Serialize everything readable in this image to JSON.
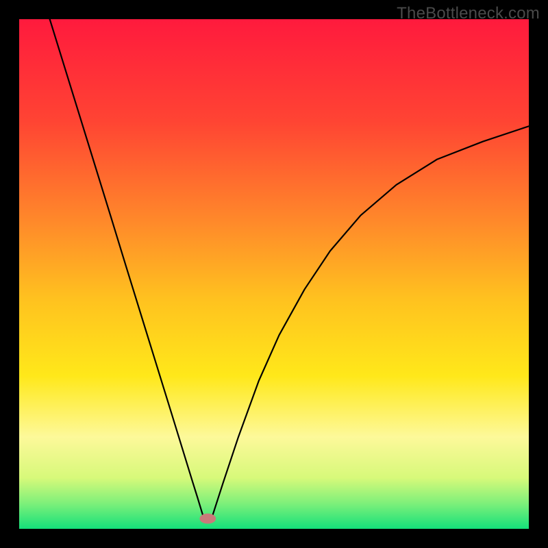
{
  "watermark": "TheBottleneck.com",
  "chart_data": {
    "type": "line",
    "title": "",
    "xlabel": "",
    "ylabel": "",
    "xlim": [
      0,
      1
    ],
    "ylim": [
      0,
      1
    ],
    "background": {
      "type": "vertical-gradient",
      "stops": [
        {
          "pos": 0.0,
          "color": "#ff1a3d"
        },
        {
          "pos": 0.2,
          "color": "#ff4433"
        },
        {
          "pos": 0.4,
          "color": "#ff8a2a"
        },
        {
          "pos": 0.55,
          "color": "#ffc21f"
        },
        {
          "pos": 0.7,
          "color": "#ffe81a"
        },
        {
          "pos": 0.82,
          "color": "#fdf99a"
        },
        {
          "pos": 0.9,
          "color": "#d7f97a"
        },
        {
          "pos": 0.95,
          "color": "#7ef07a"
        },
        {
          "pos": 1.0,
          "color": "#14e07a"
        }
      ]
    },
    "grid": false,
    "series": [
      {
        "name": "left-branch",
        "stroke": "#000000",
        "x": [
          0.06,
          0.09,
          0.12,
          0.15,
          0.18,
          0.21,
          0.24,
          0.27,
          0.3,
          0.32,
          0.34,
          0.35,
          0.36
        ],
        "y": [
          1.0,
          0.903,
          0.806,
          0.709,
          0.612,
          0.514,
          0.417,
          0.32,
          0.223,
          0.158,
          0.093,
          0.061,
          0.028
        ]
      },
      {
        "name": "right-branch",
        "stroke": "#000000",
        "x": [
          0.38,
          0.4,
          0.43,
          0.47,
          0.51,
          0.56,
          0.61,
          0.67,
          0.74,
          0.82,
          0.91,
          1.0
        ],
        "y": [
          0.028,
          0.09,
          0.18,
          0.29,
          0.38,
          0.47,
          0.545,
          0.615,
          0.675,
          0.725,
          0.76,
          0.79
        ]
      }
    ],
    "marker": {
      "name": "minimum-point",
      "x": 0.37,
      "y": 0.02,
      "rx": 0.016,
      "ry": 0.01,
      "fill": "#c97a7a"
    }
  }
}
